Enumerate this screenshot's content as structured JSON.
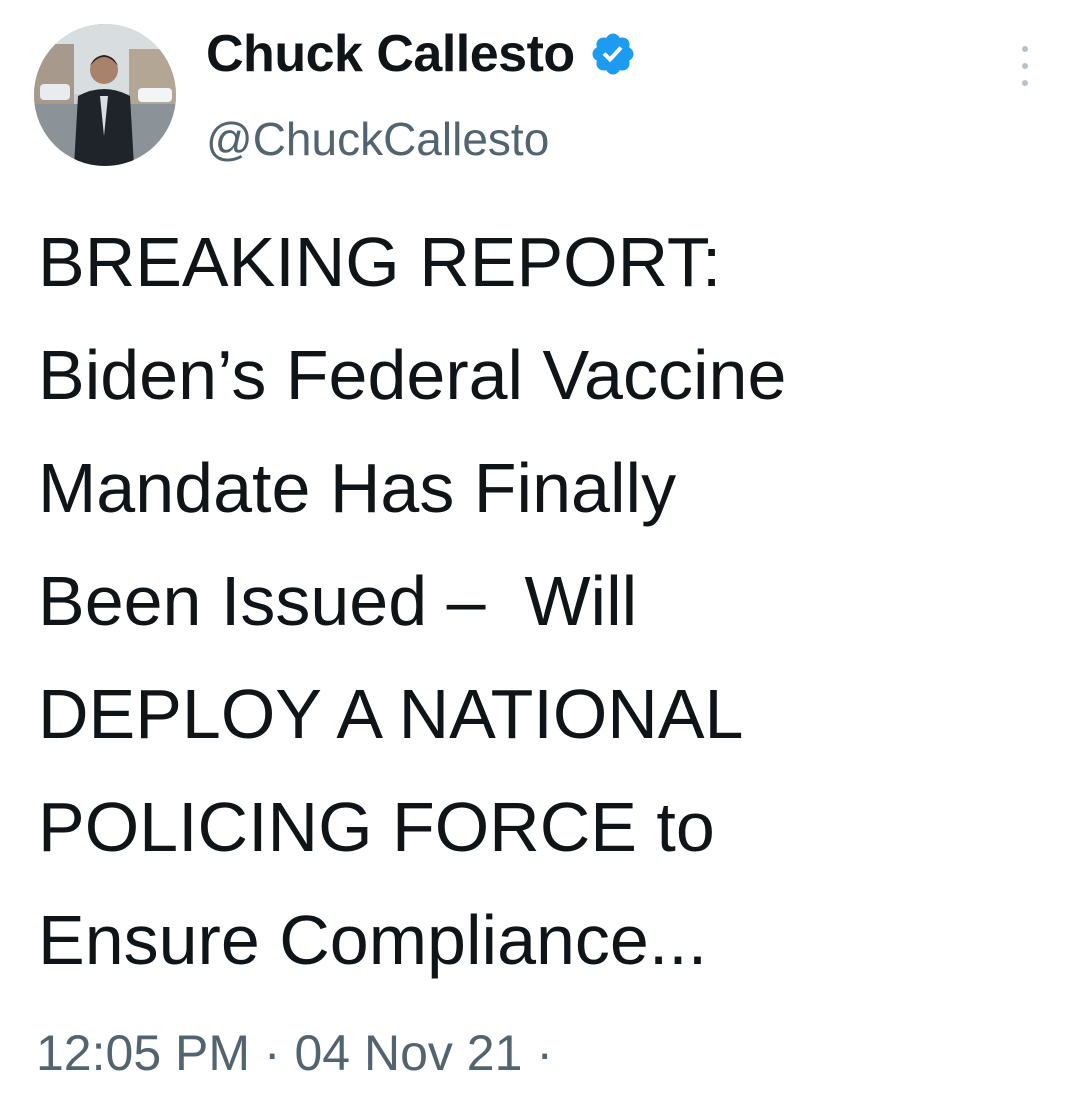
{
  "tweet": {
    "author": {
      "display_name": "Chuck Callesto",
      "handle": "@ChuckCallesto",
      "verified": true,
      "verified_icon": "verified-badge-icon",
      "avatar": "profile-photo-man-in-suit-on-street",
      "accent_color": "#1d9bf0"
    },
    "text_lines": [
      "BREAKING REPORT:",
      "Biden’s Federal Vaccine",
      "Mandate Has Finally",
      "Been Issued –  Will",
      "DEPLOY A NATIONAL",
      "POLICING FORCE to",
      "Ensure Compliance..."
    ],
    "time": "12:05 PM",
    "separator": "·",
    "date": "04 Nov 21",
    "trailing_separator": "·",
    "more_icon": "more-options-icon"
  },
  "colors": {
    "text_primary": "#0f1419",
    "text_secondary": "#536471",
    "background": "#ffffff"
  }
}
